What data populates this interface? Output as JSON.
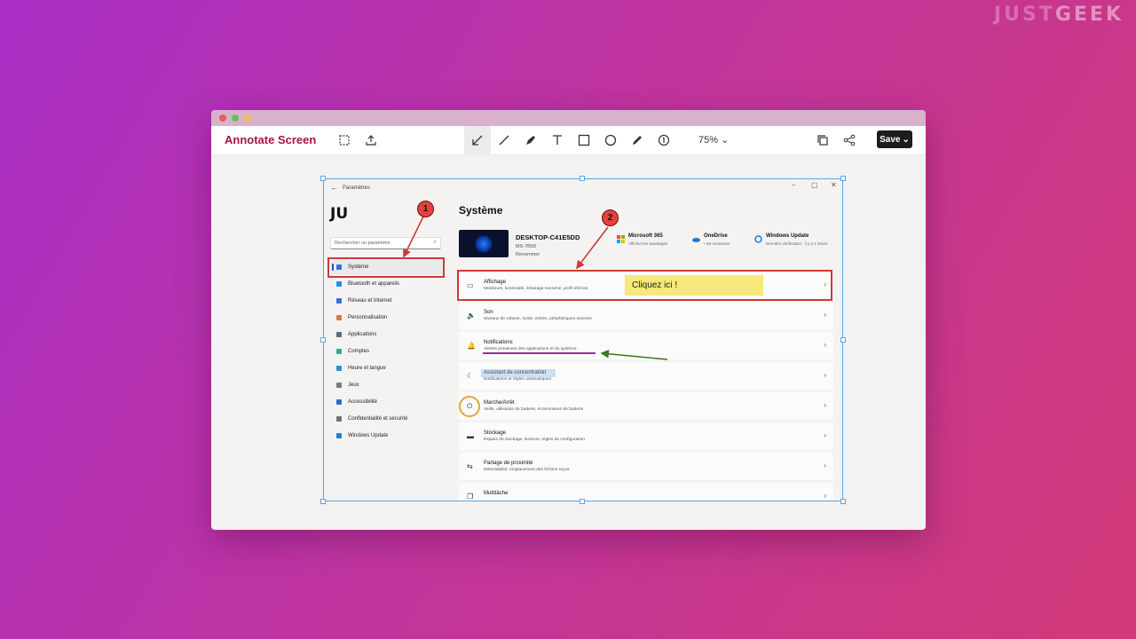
{
  "watermark": {
    "part1": "JUST",
    "part2": "GEEK"
  },
  "app": {
    "title": "Annotate Screen",
    "zoom": "75%",
    "save_label": "Save",
    "window_dots": [
      "#ee5c57",
      "#6cbc56",
      "#f3bd4f"
    ]
  },
  "toolbar_tools": [
    "crop-icon",
    "upload-icon",
    "arrow-tool-icon",
    "line-tool-icon",
    "pen-tool-icon",
    "text-tool-icon",
    "rectangle-tool-icon",
    "ellipse-tool-icon",
    "highlighter-tool-icon",
    "number-tool-icon",
    "copy-icon",
    "share-icon"
  ],
  "settings": {
    "window_title": "Paramètres",
    "avatar_text": "JU",
    "search_placeholder": "Rechercher un paramètre",
    "nav": [
      {
        "label": "Système",
        "color": "#2b78d6"
      },
      {
        "label": "Bluetooth et appareils",
        "color": "#1f8fe6"
      },
      {
        "label": "Réseau et Internet",
        "color": "#3a6fd8"
      },
      {
        "label": "Personnalisation",
        "color": "#d9774a"
      },
      {
        "label": "Applications",
        "color": "#5a6b86"
      },
      {
        "label": "Comptes",
        "color": "#2db08a"
      },
      {
        "label": "Heure et langue",
        "color": "#2b8fd6"
      },
      {
        "label": "Jeux",
        "color": "#7a7a7a"
      },
      {
        "label": "Accessibilité",
        "color": "#2a6fc4"
      },
      {
        "label": "Confidentialité et sécurité",
        "color": "#6b7280"
      },
      {
        "label": "Windows Update",
        "color": "#1c7fd1"
      }
    ],
    "page_title": "Système",
    "device": {
      "name": "DESKTOP-C41E5DD",
      "model": "MS-7B58",
      "rename": "Renommer"
    },
    "services": [
      {
        "title": "Microsoft 365",
        "desc": "Afficher les avantages"
      },
      {
        "title": "OneDrive",
        "desc": "• Se connecter"
      },
      {
        "title": "Windows Update",
        "desc": "Dernière vérification : il y a 1 heure"
      }
    ],
    "cards": [
      {
        "title": "Affichage",
        "desc": "Moniteurs, luminosité, éclairage nocturne, profil d'écran",
        "icon": "▭"
      },
      {
        "title": "Son",
        "desc": "Niveaux de volume, sortie, entrée, périphériques sonores",
        "icon": "🔈"
      },
      {
        "title": "Notifications",
        "desc": "Alertes provenant des applications et du système",
        "icon": "🔔"
      },
      {
        "title": "Assistant de concentration",
        "desc": "Notifications et règles automatiques",
        "icon": "☾"
      },
      {
        "title": "Marche/Arrêt",
        "desc": "Veille, utilisation de batterie, économiseur de batterie",
        "icon": "⏻"
      },
      {
        "title": "Stockage",
        "desc": "Espace de stockage, lecteurs, règles de configuration",
        "icon": "▬"
      },
      {
        "title": "Partage de proximité",
        "desc": "Détectabilité, emplacement des fichiers reçus",
        "icon": "⇆"
      },
      {
        "title": "Multitâche",
        "desc": "",
        "icon": "❐"
      }
    ]
  },
  "annotations": {
    "callout1": "1",
    "callout2": "2",
    "note": "Cliquez ici !"
  }
}
